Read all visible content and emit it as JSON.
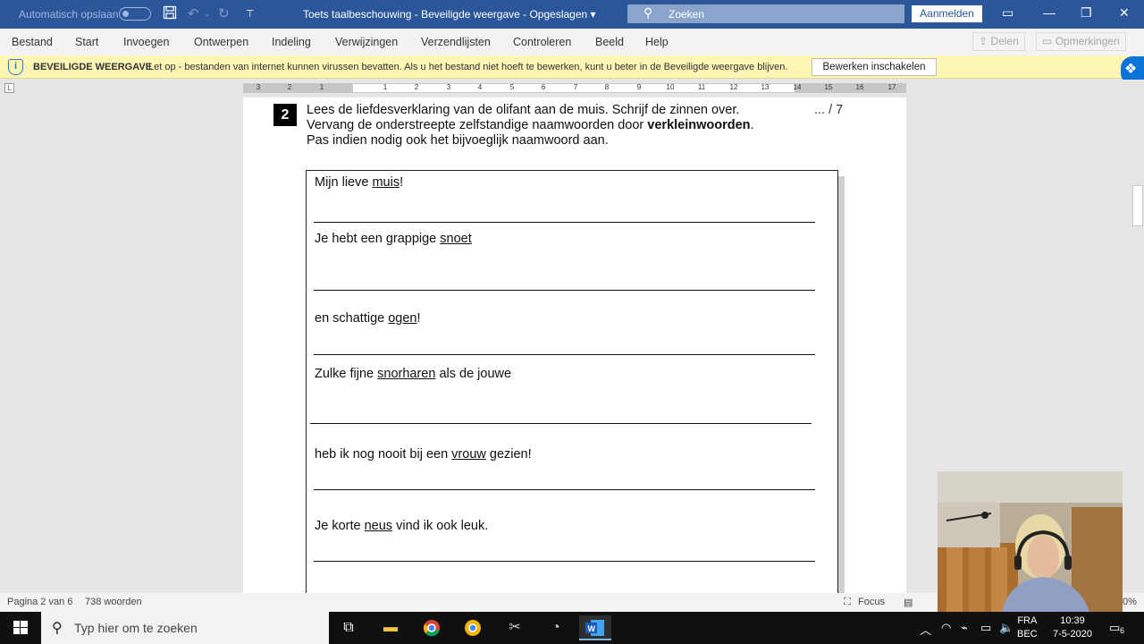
{
  "titlebar": {
    "autosave_label": "Automatisch opslaan",
    "doc_title": "Toets taalbeschouwing  -  Beveiligde weergave  -  Opgeslagen  ▾",
    "search_label": "Zoeken",
    "signin_label": "Aanmelden"
  },
  "menu": {
    "items": [
      "Bestand",
      "Start",
      "Invoegen",
      "Ontwerpen",
      "Indeling",
      "Verwijzingen",
      "Verzendlijsten",
      "Controleren",
      "Beeld",
      "Help"
    ],
    "share_label": "Delen",
    "comments_label": "Opmerkingen"
  },
  "protected_view": {
    "title": "BEVEILIGDE WEERGAVE",
    "message": "Let op - bestanden van internet kunnen virussen bevatten. Als u het bestand niet hoeft te bewerken, kunt u beter in de Beveiligde weergave blijven.",
    "enable_button": "Bewerken inschakelen"
  },
  "ruler": {
    "corner": "L",
    "numbers": [
      "3",
      "2",
      "1",
      "1",
      "2",
      "3",
      "4",
      "5",
      "6",
      "7",
      "8",
      "9",
      "10",
      "11",
      "12",
      "13",
      "14",
      "15",
      "16",
      "17"
    ]
  },
  "document": {
    "question_number": "2",
    "instruction_line1": "Lees de liefdesverklaring van de olifant aan de muis. Schrijf de zinnen over.",
    "instruction_line2_a": "Vervang de onderstreepte zelfstandige naamwoorden door ",
    "instruction_line2_bold": "verkleinwoorden",
    "instruction_line2_c": ".",
    "instruction_line3": "Pas indien nodig ook het bijvoeglijk naamwoord aan.",
    "score": "... / 7",
    "sentences": [
      {
        "before": "Mijn lieve ",
        "underlined": "muis",
        "after": "!"
      },
      {
        "before": "Je hebt een grappige ",
        "underlined": "snoet",
        "after": ""
      },
      {
        "before": "en schattige ",
        "underlined": "ogen",
        "after": "!"
      },
      {
        "before": "Zulke fijne ",
        "underlined": "snorharen",
        "after": " als de jouwe"
      },
      {
        "before": "heb ik nog nooit bij een ",
        "underlined": "vrouw",
        "after": " gezien!"
      },
      {
        "before": "Je korte ",
        "underlined": "neus",
        "after": " vind ik ook leuk."
      }
    ]
  },
  "statusbar": {
    "page": "Pagina 2 van 6",
    "words": "738 woorden",
    "focus": "Focus",
    "zoom": "0%"
  },
  "taskbar": {
    "search_placeholder": "Typ hier om te zoeken",
    "lang_line1": "FRA",
    "lang_line2": "BEC",
    "time": "10:39",
    "date": "7-5-2020",
    "notification_count": "6"
  }
}
